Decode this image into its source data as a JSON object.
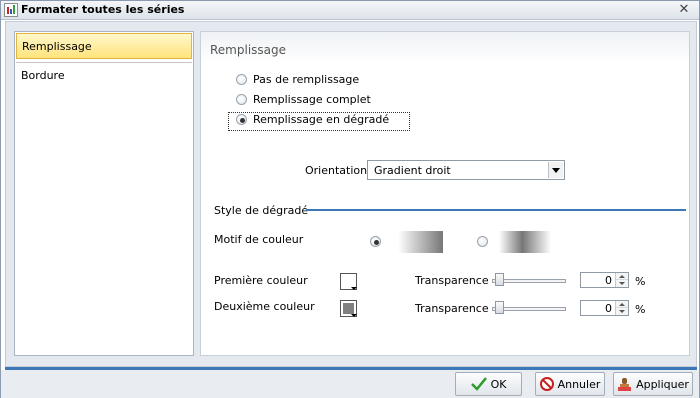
{
  "window": {
    "title": "Formater toutes les séries"
  },
  "sidebar": {
    "items": [
      {
        "label": "Remplissage",
        "active": true
      },
      {
        "label": "Bordure",
        "active": false
      }
    ]
  },
  "main": {
    "section_title": "Remplissage",
    "fill_options": [
      {
        "label": "Pas de remplissage",
        "checked": false
      },
      {
        "label": "Remplissage complet",
        "checked": false
      },
      {
        "label": "Remplissage en dégradé",
        "checked": true
      }
    ],
    "orientation": {
      "label": "Orientation",
      "value": "Gradient droit"
    },
    "gradient_style": {
      "title": "Style de dégradé",
      "pattern_label": "Motif de couleur",
      "pattern_selected": "linear",
      "first_color": {
        "label": "Première couleur",
        "color": "#ffffff"
      },
      "second_color": {
        "label": "Deuxième couleur",
        "color": "#808080"
      },
      "transparency1": {
        "label": "Transparence",
        "value": "0",
        "unit": "%"
      },
      "transparency2": {
        "label": "Transparence",
        "value": "0",
        "unit": "%"
      }
    }
  },
  "footer": {
    "ok_label": "OK",
    "cancel_label": "Annuler",
    "apply_label": "Appliquer"
  },
  "colors": {
    "accent": "#3c78b8",
    "selection": "#ffe37a"
  }
}
